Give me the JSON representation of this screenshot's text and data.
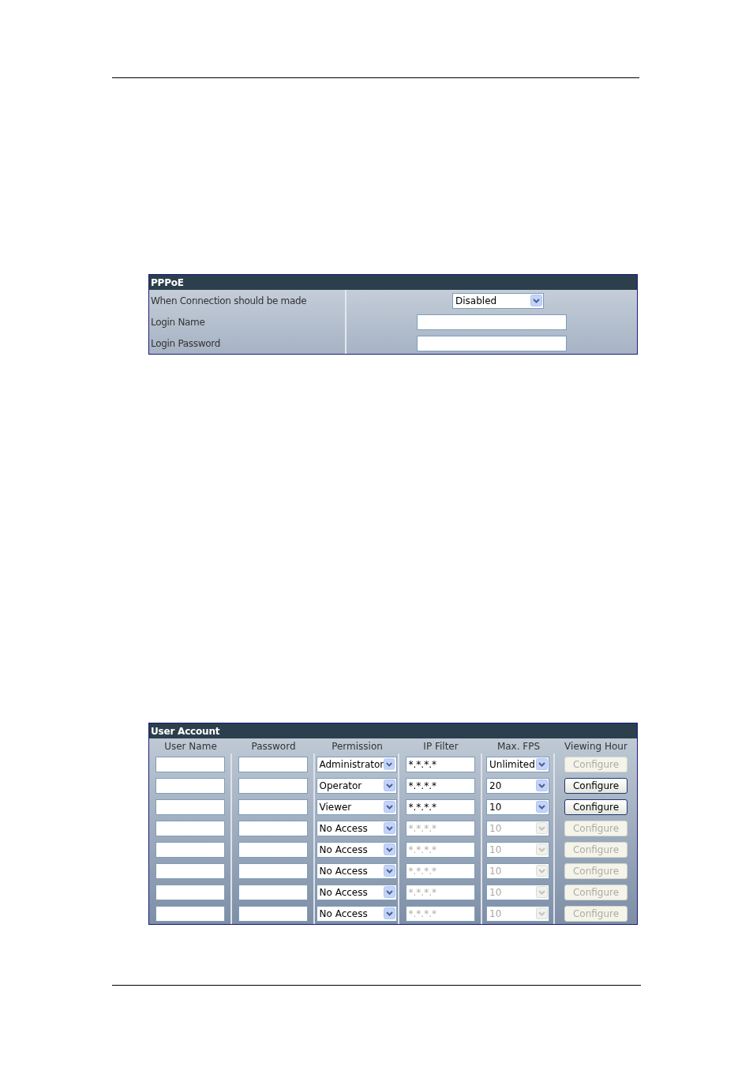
{
  "pppoe": {
    "title": "PPPoE",
    "rows": [
      {
        "label": "When Connection should be made",
        "kind": "select",
        "value": "Disabled"
      },
      {
        "label": "Login Name",
        "kind": "input",
        "value": ""
      },
      {
        "label": "Login Password",
        "kind": "input",
        "value": ""
      }
    ]
  },
  "user_account": {
    "title": "User Account",
    "columns": [
      "User Name",
      "Password",
      "Permission",
      "IP Filter",
      "Max. FPS",
      "Viewing Hour"
    ],
    "rows": [
      {
        "permission": "Administrator",
        "ip_filter": "*.*.*.*",
        "ip_disabled": false,
        "max_fps": "Unlimited",
        "fps_disabled": false,
        "button": "Configure",
        "button_disabled": true
      },
      {
        "permission": "Operator",
        "ip_filter": "*.*.*.*",
        "ip_disabled": false,
        "max_fps": "20",
        "fps_disabled": false,
        "button": "Configure",
        "button_disabled": false
      },
      {
        "permission": "Viewer",
        "ip_filter": "*.*.*.*",
        "ip_disabled": false,
        "max_fps": "10",
        "fps_disabled": false,
        "button": "Configure",
        "button_disabled": false
      },
      {
        "permission": "No Access",
        "ip_filter": "*.*.*.*",
        "ip_disabled": true,
        "max_fps": "10",
        "fps_disabled": true,
        "button": "Configure",
        "button_disabled": true
      },
      {
        "permission": "No Access",
        "ip_filter": "*.*.*.*",
        "ip_disabled": true,
        "max_fps": "10",
        "fps_disabled": true,
        "button": "Configure",
        "button_disabled": true
      },
      {
        "permission": "No Access",
        "ip_filter": "*.*.*.*",
        "ip_disabled": true,
        "max_fps": "10",
        "fps_disabled": true,
        "button": "Configure",
        "button_disabled": true
      },
      {
        "permission": "No Access",
        "ip_filter": "*.*.*.*",
        "ip_disabled": true,
        "max_fps": "10",
        "fps_disabled": true,
        "button": "Configure",
        "button_disabled": true
      },
      {
        "permission": "No Access",
        "ip_filter": "*.*.*.*",
        "ip_disabled": true,
        "max_fps": "10",
        "fps_disabled": true,
        "button": "Configure",
        "button_disabled": true
      }
    ]
  }
}
